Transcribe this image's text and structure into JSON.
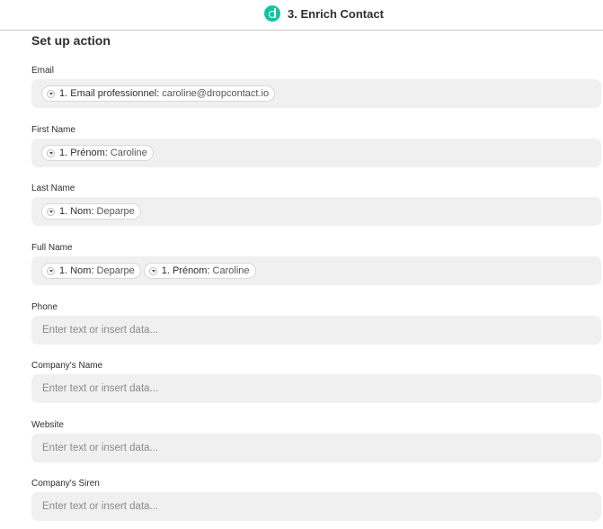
{
  "header": {
    "step_title": "3. Enrich Contact",
    "app_icon": "dropcontact-logo-icon",
    "accent": "#13c3a2"
  },
  "section_title": "Set up action",
  "fields": [
    {
      "label": "Email",
      "pills": [
        {
          "key": "1. Email professionnel:",
          "value": "caroline@dropcontact.io"
        }
      ]
    },
    {
      "label": "First Name",
      "pills": [
        {
          "key": "1. Prénom:",
          "value": "Caroline"
        }
      ]
    },
    {
      "label": "Last Name",
      "pills": [
        {
          "key": "1. Nom:",
          "value": "Deparpe"
        }
      ]
    },
    {
      "label": "Full Name",
      "pills": [
        {
          "key": "1. Nom:",
          "value": "Deparpe"
        },
        {
          "key": "1. Prénom:",
          "value": "Caroline"
        }
      ]
    },
    {
      "label": "Phone",
      "placeholder": "Enter text or insert data..."
    },
    {
      "label": "Company's Name",
      "placeholder": "Enter text or insert data..."
    },
    {
      "label": "Website",
      "placeholder": "Enter text or insert data..."
    },
    {
      "label": "Company's Siren",
      "placeholder": "Enter text or insert data..."
    }
  ]
}
